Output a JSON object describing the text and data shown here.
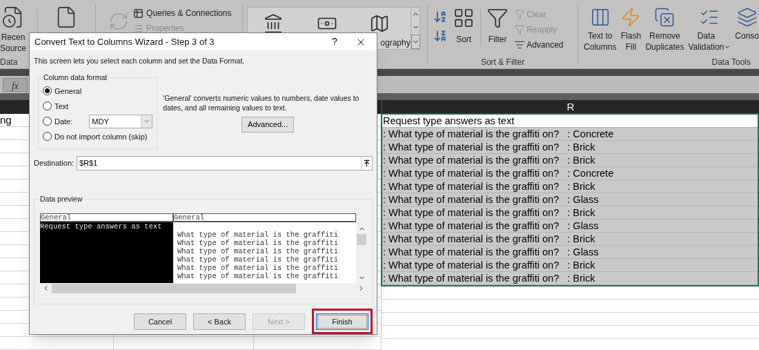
{
  "ribbon": {
    "get_data": {
      "label": "Data",
      "recent_sources": [
        "Recen",
        "Source"
      ]
    },
    "queries": [
      {
        "label": "Queries & Connections",
        "disabled": false
      },
      {
        "label": "Properties",
        "disabled": true
      }
    ],
    "gallery": {
      "label": "ography"
    },
    "sort_filter": {
      "label": "Sort & Filter",
      "sort": "Sort",
      "filter": "Filter",
      "options": [
        {
          "label": "Clear",
          "disabled": true
        },
        {
          "label": "Reapply",
          "disabled": true
        },
        {
          "label": "Advanced",
          "disabled": false
        }
      ]
    },
    "data_tools": {
      "label": "Data Tools",
      "commands": [
        {
          "lines": [
            "Text to",
            "Columns"
          ],
          "dropdown": false
        },
        {
          "lines": [
            "Flash",
            "Fill"
          ],
          "dropdown": false
        },
        {
          "lines": [
            "Remove",
            "Duplicates"
          ],
          "dropdown": false
        },
        {
          "lines": [
            "Data",
            "Validation"
          ],
          "dropdown": true
        },
        {
          "lines": [
            "Conso"
          ],
          "dropdown": false
        }
      ]
    }
  },
  "formula_bar": {
    "function_button": "fx"
  },
  "sheet": {
    "column_header": "R",
    "left_cell": "ng",
    "rows": [
      {
        "text": "Request type answers as text",
        "selected": false
      },
      {
        "text": ": What type of material is the graffiti on?   : Concrete",
        "selected": true
      },
      {
        "text": ": What type of material is the graffiti on?   : Brick",
        "selected": true
      },
      {
        "text": ": What type of material is the graffiti on?   : Brick",
        "selected": true
      },
      {
        "text": ": What type of material is the graffiti on?   : Concrete",
        "selected": true
      },
      {
        "text": ": What type of material is the graffiti on?   : Brick",
        "selected": true
      },
      {
        "text": ": What type of material is the graffiti on?   : Glass",
        "selected": true
      },
      {
        "text": ": What type of material is the graffiti on?   : Brick",
        "selected": true
      },
      {
        "text": ": What type of material is the graffiti on?   : Glass",
        "selected": true
      },
      {
        "text": ": What type of material is the graffiti on?   : Brick",
        "selected": true
      },
      {
        "text": ": What type of material is the graffiti on?   : Glass",
        "selected": true
      },
      {
        "text": ": What type of material is the graffiti on?   : Brick",
        "selected": true
      },
      {
        "text": ": What type of material is the graffiti on?   : Brick",
        "selected": true
      }
    ]
  },
  "dialog": {
    "title": "Convert Text to Columns Wizard - Step 3 of 3",
    "help": "?",
    "description": "This screen lets you select each column and set the Data Format.",
    "format_group": {
      "legend": "Column data format",
      "options": [
        {
          "kind": "plain",
          "label": "General",
          "selected": true
        },
        {
          "kind": "plain",
          "label": "Text",
          "selected": false
        },
        {
          "kind": "date",
          "label": "Date:",
          "selected": false,
          "value": "MDY"
        },
        {
          "kind": "plain",
          "label": "Do not import column (skip)",
          "selected": false
        }
      ]
    },
    "hint": "'General' converts numeric values to numbers, date values to dates, and all remaining values to text.",
    "advanced_button": "Advanced...",
    "destination": {
      "label": "Destination:",
      "value": "$R$1"
    },
    "preview": {
      "legend": "Data preview",
      "columns": [
        {
          "header": "General",
          "selected": true
        },
        {
          "header": "General",
          "selected": false
        }
      ],
      "rows": [
        [
          "Request type answers as text",
          null
        ],
        [
          null,
          "What type of material is the graffiti"
        ],
        [
          null,
          "What type of material is the graffiti"
        ],
        [
          null,
          "What type of material is the graffiti"
        ],
        [
          null,
          "What type of material is the graffiti"
        ],
        [
          null,
          "What type of material is the graffiti"
        ],
        [
          null,
          "What type of material is the graffiti"
        ]
      ]
    },
    "buttons": [
      {
        "label": "Cancel",
        "disabled": false,
        "default": false,
        "highlighted": false
      },
      {
        "label": "< Back",
        "disabled": false,
        "default": false,
        "highlighted": false
      },
      {
        "label": "Next >",
        "disabled": true,
        "default": false,
        "highlighted": false
      },
      {
        "label": "Finish",
        "disabled": false,
        "default": true,
        "highlighted": true
      }
    ]
  }
}
